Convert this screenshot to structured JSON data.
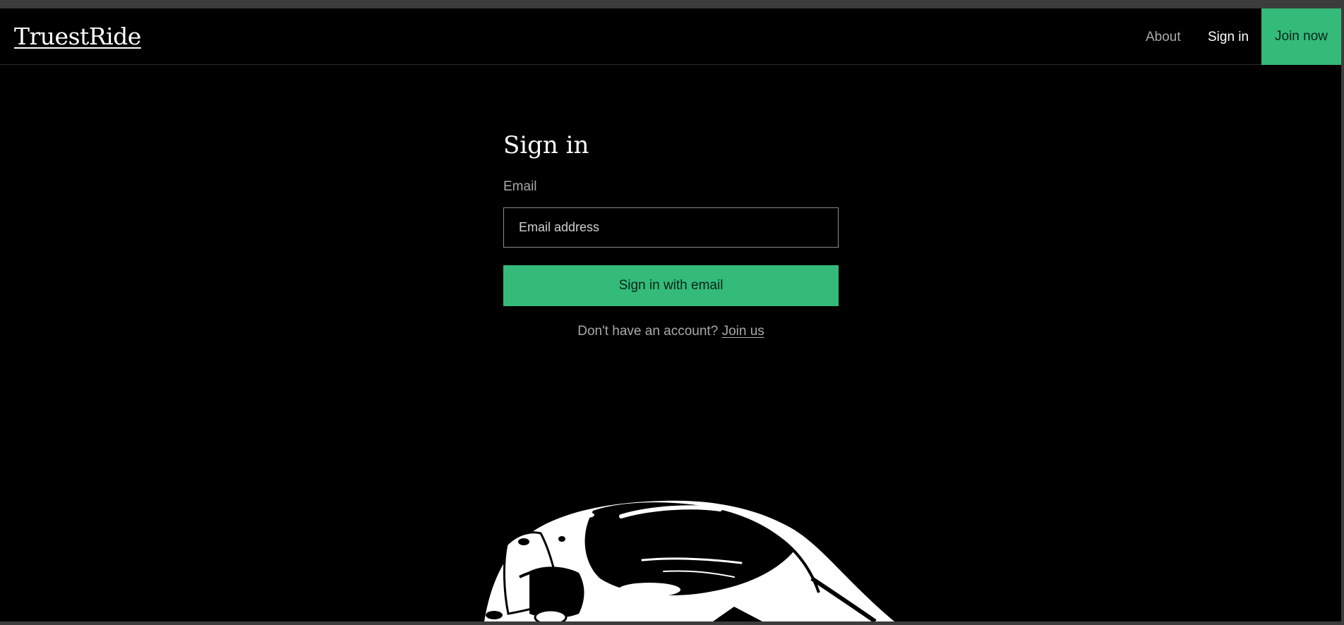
{
  "header": {
    "logo": "TruestRide",
    "nav": {
      "about": "About",
      "sign_in": "Sign in",
      "join_now": "Join now"
    }
  },
  "form": {
    "title": "Sign in",
    "email_label": "Email",
    "email_placeholder": "Email address",
    "email_value": "",
    "submit_label": "Sign in with email",
    "no_account_text": "Don't have an account?",
    "join_link": "Join us"
  },
  "colors": {
    "background": "#000000",
    "accent": "#34bb79",
    "muted_text": "#a9a9a9",
    "browser_frame": "#3c3c3c"
  },
  "icons": {
    "hero_illustration": "helmet-illustration-icon"
  }
}
